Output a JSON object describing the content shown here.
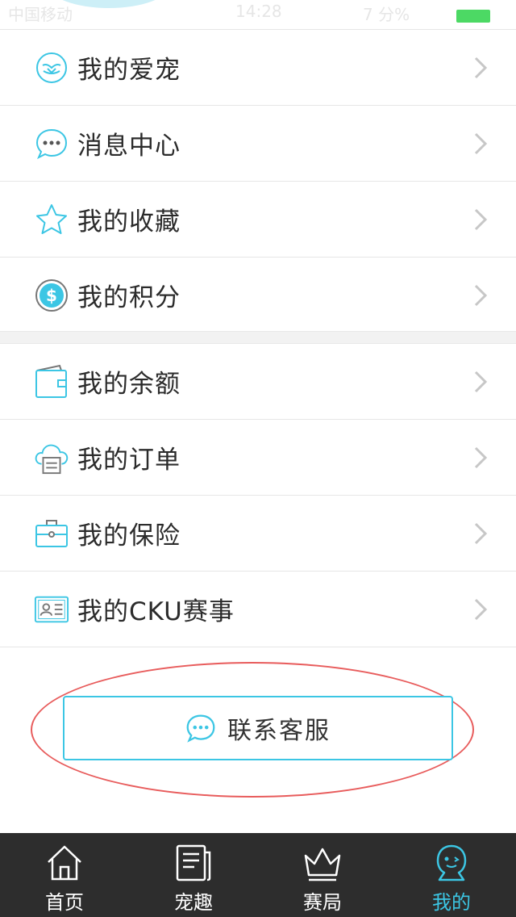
{
  "status_bar": {
    "carrier": "中国移动",
    "time": "14:28",
    "right": "7 分% ",
    "battery_color": "#4cd964"
  },
  "menu_group_1": [
    {
      "label": "我的爱宠",
      "icon": "pet-face-icon"
    },
    {
      "label": "消息中心",
      "icon": "chat-bubble-icon"
    },
    {
      "label": "我的收藏",
      "icon": "star-icon"
    },
    {
      "label": "我的积分",
      "icon": "dollar-coin-icon"
    }
  ],
  "menu_group_2": [
    {
      "label": "我的余额",
      "icon": "wallet-icon"
    },
    {
      "label": "我的订单",
      "icon": "cloud-order-icon"
    },
    {
      "label": "我的保险",
      "icon": "briefcase-icon"
    },
    {
      "label": "我的CKU赛事",
      "icon": "id-card-icon"
    }
  ],
  "contact_button": {
    "label": "联系客服",
    "icon": "chat-bubble-icon"
  },
  "tabs": [
    {
      "label": "首页",
      "icon": "home-icon",
      "active": false
    },
    {
      "label": "宠趣",
      "icon": "news-icon",
      "active": false
    },
    {
      "label": "赛局",
      "icon": "crown-icon",
      "active": false
    },
    {
      "label": "我的",
      "icon": "profile-icon",
      "active": true
    }
  ],
  "colors": {
    "accent": "#3cc6e4",
    "tabbar_bg": "#2d2d2d",
    "highlight_ellipse": "#e85c5c"
  }
}
